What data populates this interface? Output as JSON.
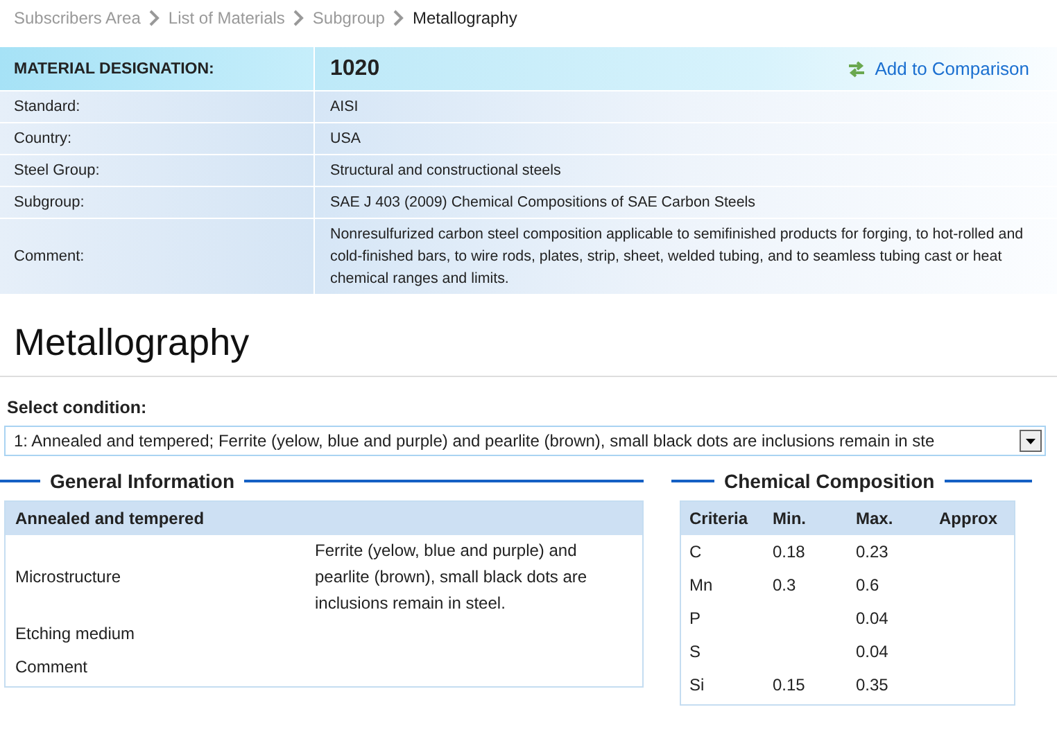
{
  "breadcrumb": [
    {
      "label": "Subscribers Area",
      "current": false
    },
    {
      "label": "List of Materials",
      "current": false
    },
    {
      "label": "Subgroup",
      "current": false
    },
    {
      "label": "Metallography",
      "current": true
    }
  ],
  "designation": {
    "label": "MATERIAL DESIGNATION:",
    "value": "1020",
    "action": "Add to Comparison"
  },
  "properties": [
    {
      "label": "Standard:",
      "value": "AISI"
    },
    {
      "label": "Country:",
      "value": "USA"
    },
    {
      "label": "Steel Group:",
      "value": "Structural and constructional steels"
    },
    {
      "label": "Subgroup:",
      "value": "SAE J 403 (2009) Chemical Compositions of SAE Carbon Steels"
    },
    {
      "label": "Comment:",
      "value": "Nonresulfurized carbon steel composition applicable to semifinished products for forging, to hot-rolled and cold-finished bars, to wire rods, plates, strip, sheet, welded tubing, and to seamless tubing cast or heat chemical ranges and limits."
    }
  ],
  "page_title": "Metallography",
  "condition": {
    "label": "Select condition:",
    "value": "1: Annealed and tempered; Ferrite (yelow, blue and purple) and pearlite (brown), small black dots are inclusions remain in ste"
  },
  "general_information": {
    "title": "General Information",
    "header": "Annealed and tempered",
    "rows": [
      {
        "label": "Microstructure",
        "value": "Ferrite (yelow, blue and purple) and pearlite (brown), small black dots are inclusions remain in steel."
      },
      {
        "label": "Etching medium",
        "value": ""
      },
      {
        "label": "Comment",
        "value": ""
      }
    ]
  },
  "chemical_composition": {
    "title": "Chemical Composition",
    "columns": [
      "Criteria",
      "Min.",
      "Max.",
      "Approx"
    ],
    "rows": [
      [
        "C",
        "0.18",
        "0.23",
        ""
      ],
      [
        "Mn",
        "0.3",
        "0.6",
        ""
      ],
      [
        "P",
        "",
        "0.04",
        ""
      ],
      [
        "S",
        "",
        "0.04",
        ""
      ],
      [
        "Si",
        "0.15",
        "0.35",
        ""
      ]
    ]
  }
}
